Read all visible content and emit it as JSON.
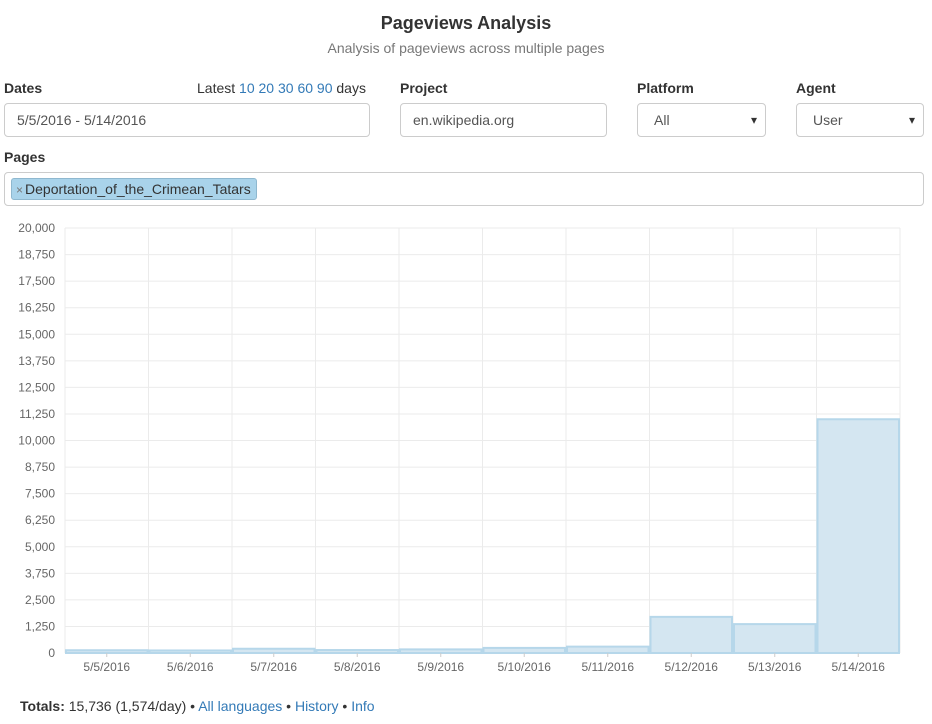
{
  "header": {
    "title": "Pageviews Analysis",
    "subtitle": "Analysis of pageviews across multiple pages"
  },
  "dates": {
    "label": "Dates",
    "value": "5/5/2016 - 5/14/2016",
    "latest_prefix": "Latest",
    "latest_options": [
      "10",
      "20",
      "30",
      "60",
      "90"
    ],
    "latest_suffix": "days"
  },
  "project": {
    "label": "Project",
    "value": "en.wikipedia.org"
  },
  "platform": {
    "label": "Platform",
    "value": "All"
  },
  "agent": {
    "label": "Agent",
    "value": "User"
  },
  "pages": {
    "label": "Pages",
    "tags": [
      "Deportation_of_the_Crimean_Tatars"
    ]
  },
  "chart_data": {
    "type": "bar",
    "categories": [
      "5/5/2016",
      "5/6/2016",
      "5/7/2016",
      "5/8/2016",
      "5/9/2016",
      "5/10/2016",
      "5/11/2016",
      "5/12/2016",
      "5/13/2016",
      "5/14/2016"
    ],
    "series": [
      {
        "values": [
          130,
          120,
          200,
          140,
          170,
          240,
          300,
          1700,
          1360,
          11000
        ],
        "color": "#d4e6f1",
        "border": "#b6d7ea"
      }
    ],
    "ylim": [
      0,
      20000
    ],
    "yticks": [
      "0",
      "1,250",
      "2,500",
      "3,750",
      "5,000",
      "6,250",
      "7,500",
      "8,750",
      "10,000",
      "11,250",
      "12,500",
      "13,750",
      "15,000",
      "16,250",
      "17,500",
      "18,750",
      "20,000"
    ],
    "grid": true,
    "xlabel": "",
    "ylabel": ""
  },
  "totals": {
    "label": "Totals:",
    "value": "15,736 (1,574/day)",
    "links": [
      "All languages",
      "History",
      "Info"
    ],
    "separator": "•"
  }
}
